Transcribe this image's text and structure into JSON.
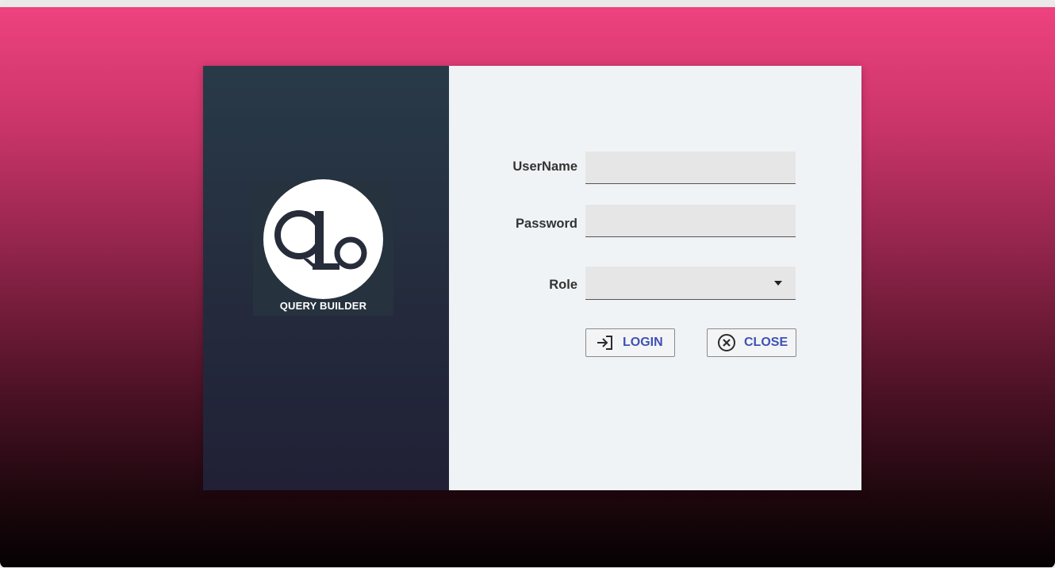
{
  "brand": {
    "logo_text": "QUERY BUILDER",
    "logo_monogram": "Qb"
  },
  "form": {
    "username": {
      "label": "UserName",
      "value": "",
      "placeholder": ""
    },
    "password": {
      "label": "Password",
      "value": "",
      "placeholder": ""
    },
    "role": {
      "label": "Role",
      "selected": ""
    }
  },
  "buttons": {
    "login_label": "LOGIN",
    "close_label": "CLOSE"
  },
  "icons": {
    "login": "login-arrow-icon",
    "close": "close-circle-icon",
    "dropdown": "chevron-down-icon"
  },
  "colors": {
    "accent": "#3f51b5",
    "backdrop_top": "#ee427e",
    "backdrop_bottom": "#050102",
    "brand_panel": "#283a48",
    "form_panel": "#f0f3f6",
    "input_bg": "#e6e6e6"
  }
}
